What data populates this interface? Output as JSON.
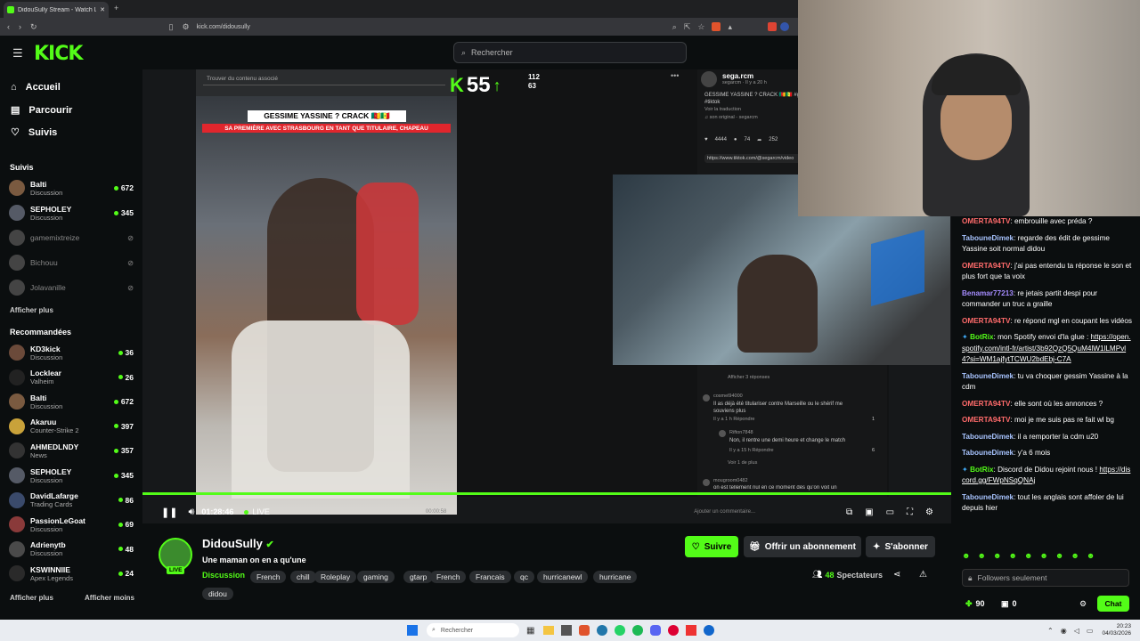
{
  "browser": {
    "tab_title": "DidouSully Stream - Watch Li",
    "url": "kick.com/didousully"
  },
  "header": {
    "logo": "KICK",
    "search_placeholder": "Rechercher"
  },
  "nav": [
    {
      "label": "Accueil",
      "icon": "home-icon"
    },
    {
      "label": "Parcourir",
      "icon": "browse-icon"
    },
    {
      "label": "Suivis",
      "icon": "heart-icon"
    }
  ],
  "followed": {
    "title": "Suivis",
    "items": [
      {
        "name": "Balti",
        "category": "Discussion",
        "viewers": "672",
        "live": true,
        "color": "#7a5a40"
      },
      {
        "name": "SEPHOLEY",
        "category": "Discussion",
        "viewers": "345",
        "live": true,
        "color": "#555a66"
      },
      {
        "name": "gamemixtreize",
        "category": "",
        "viewers": "",
        "live": false,
        "color": "#444"
      },
      {
        "name": "Bichouu",
        "category": "",
        "viewers": "",
        "live": false,
        "color": "#444"
      },
      {
        "name": "Jolavanille",
        "category": "",
        "viewers": "",
        "live": false,
        "color": "#444"
      }
    ],
    "more": "Afficher plus"
  },
  "recommended": {
    "title": "Recommandées",
    "items": [
      {
        "name": "KD3kick",
        "category": "Discussion",
        "viewers": "36",
        "color": "#6b4a3a"
      },
      {
        "name": "Locklear",
        "category": "Valheim",
        "viewers": "26",
        "color": "#222"
      },
      {
        "name": "Balti",
        "category": "Discussion",
        "viewers": "672",
        "color": "#7a5a40"
      },
      {
        "name": "Akaruu",
        "category": "Counter-Strike 2",
        "viewers": "397",
        "color": "#c9a23a"
      },
      {
        "name": "AHMEDLNDY",
        "category": "News",
        "viewers": "357",
        "color": "#333"
      },
      {
        "name": "SEPHOLEY",
        "category": "Discussion",
        "viewers": "345",
        "color": "#555a66"
      },
      {
        "name": "DavidLafarge",
        "category": "Trading Cards",
        "viewers": "86",
        "color": "#3a4a6b"
      },
      {
        "name": "PassionLeGoat",
        "category": "Discussion",
        "viewers": "69",
        "color": "#8a3a3a"
      },
      {
        "name": "Adrienytb",
        "category": "Discussion",
        "viewers": "48",
        "color": "#4a4a4a"
      },
      {
        "name": "KSWINNIIE",
        "category": "Apex Legends",
        "viewers": "24",
        "color": "#2a2a2a"
      }
    ],
    "more": "Afficher plus",
    "less": "Afficher moins"
  },
  "video": {
    "tiktok_search": "Trouver du contenu associé",
    "overlay_title": "GESSIME YASSINE ? CRACK 🇨🇲🇸🇳",
    "overlay_sub": "SA PREMIÈRE AVEC STRASBOURG EN TANT QUE TITULAIRE, CHAPEAU",
    "kick_badge": "55",
    "kick_up": "112",
    "kick_down": "63",
    "post_user": "sega.rcm",
    "post_meta": "segarcm · Il y a 20 h",
    "post_caption": "GESSIME YASSINE ? CRACK 🇨🇲🇸🇳 #gessime #coupedefrance #football #tiktok",
    "post_translate": "Voir la traduction",
    "post_sound": "♫ son original - segarcm",
    "post_likes": "4444",
    "post_comments": "74",
    "post_shares": "252",
    "post_link": "https://www.tiktok.com/@segarcm/video",
    "replies": "Afficher 3 réponses",
    "comment1_user": "cosmel94000",
    "comment1": "Il as déjà été titulariser contre Marseille ou le shérif me souviens plus",
    "comment1_meta": "Il y a 1 h   Répondre",
    "comment1_likes": "1",
    "comment2_user": "Rifton7848",
    "comment2": "Non, il rentre une demi heure et change le match",
    "comment2_meta": "Il y a 15 h   Répondre",
    "comment2_likes": "6",
    "see_more": "Voir 1 de plus",
    "comment3_user": "mougroom0482",
    "comment3": "on est tellement nul en ce moment dès qu'on voit un",
    "add_comment": "Ajouter un commentaire...",
    "time": "01:28:46",
    "live": "LIVE",
    "overlay_time": "00:00:58"
  },
  "stream": {
    "channel": "DidouSully",
    "title": "Une maman on en a qu'une",
    "live": "LIVE",
    "category": "Discussion",
    "tags": [
      "French",
      "chill",
      "Roleplay",
      "gaming",
      "gtarp",
      "French",
      "Francais",
      "qc",
      "hurricanewl",
      "hurricane",
      "didou"
    ],
    "follow": "Suivre",
    "gift": "Offrir un abonnement",
    "subscribe": "S'abonner",
    "viewers": "48",
    "viewers_label": "Spectateurs"
  },
  "chat": {
    "messages": [
      {
        "user": "OMERTA94TV",
        "color": "#ff6b6b",
        "text": "embrouille avec préda ?"
      },
      {
        "user": "TabouneDimek",
        "color": "#a8c4ff",
        "text": "regarde des édit de gessime Yassine soit normal didou"
      },
      {
        "user": "OMERTA94TV",
        "color": "#ff6b6b",
        "text": "j'ai pas entendu ta réponse le son et plus fort que ta voix"
      },
      {
        "user": "Benamar77213",
        "color": "#a58cff",
        "text": "re jetais partit despi pour commander un truc a graille"
      },
      {
        "user": "OMERTA94TV",
        "color": "#ff6b6b",
        "text": "re répond mgl en coupant les vidéos"
      },
      {
        "user": "BotRix",
        "color": "#53fc18",
        "text": "mon Spotify envoi d'la glue : ",
        "link": "https://open.spotify.com/intl-fr/artist/3b92QzQ5QuM4lW1lLMPvl4?si=WM1ajfytTCWU2bdEbj-C7A",
        "bot": true
      },
      {
        "user": "TabouneDimek",
        "color": "#a8c4ff",
        "text": "tu va choquer gessim Yassine à la cdm"
      },
      {
        "user": "OMERTA94TV",
        "color": "#ff6b6b",
        "text": "elle sont où les annonces ?"
      },
      {
        "user": "OMERTA94TV",
        "color": "#ff6b6b",
        "text": "moi je me suis pas re fait wl bg"
      },
      {
        "user": "TabouneDimek",
        "color": "#a8c4ff",
        "text": "il a remporter la cdm u20"
      },
      {
        "user": "TabouneDimek",
        "color": "#a8c4ff",
        "text": "y'a 6 mois"
      },
      {
        "user": "BotRix",
        "color": "#53fc18",
        "text": "Discord de Didou rejoint nous ! ",
        "link": "https://discord.gg/FWpNSqQNAj",
        "bot": true
      },
      {
        "user": "TabouneDimek",
        "color": "#a8c4ff",
        "text": "tout les anglais sont affoler de lui depuis hier"
      }
    ],
    "followers_only": "Followers seulement",
    "points": "90",
    "subs": "0",
    "send": "Chat"
  },
  "taskbar": {
    "search": "Rechercher",
    "time": "20:23",
    "date": "04/03/2026"
  },
  "colors": {
    "accent": "#53fc18",
    "bg": "#0b0e0f"
  }
}
